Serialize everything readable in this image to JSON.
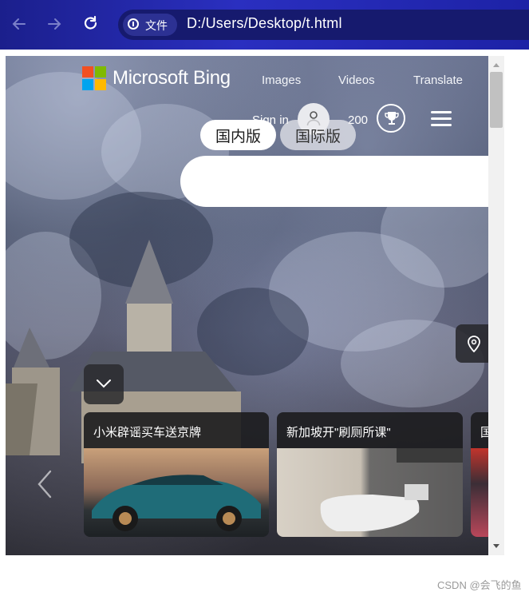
{
  "browser": {
    "back_icon": "arrow-left-icon",
    "forward_icon": "arrow-right-icon",
    "reload_icon": "reload-icon",
    "security_chip_label": "文件",
    "address": "D:/Users/Desktop/t.html",
    "toolbar_color": "#2a2fc0"
  },
  "bing": {
    "brand": "Microsoft Bing",
    "nav": [
      "Images",
      "Videos",
      "Translate"
    ],
    "sign_in": "Sign in",
    "points": "200",
    "region_tabs": [
      "国内版",
      "国际版"
    ],
    "search_placeholder": ""
  },
  "news": {
    "cards": [
      {
        "title": "小米辟谣买车送京牌"
      },
      {
        "title": "新加坡开\"刷厕所课\""
      },
      {
        "title": "国"
      }
    ]
  },
  "watermark": "CSDN @会飞的鱼"
}
